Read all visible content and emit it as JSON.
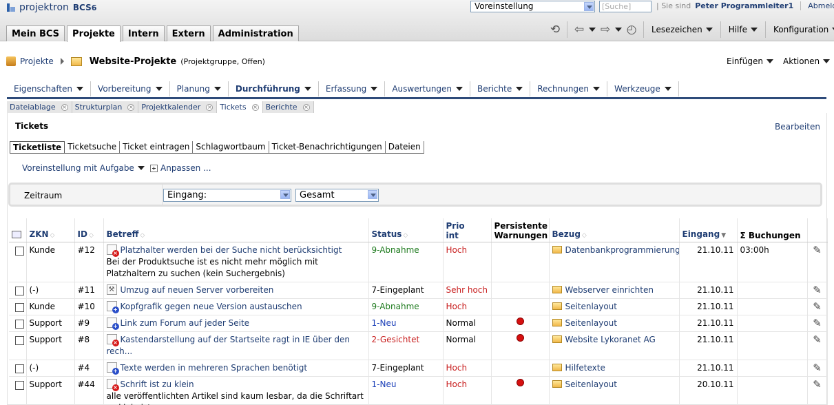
{
  "app": {
    "logo_text": "projektron",
    "logo_version": "BCS",
    "logo_num": "6"
  },
  "top": {
    "preset_value": "Voreinstellung",
    "search_placeholder": "[Suche]",
    "user_prefix": "Sie sind",
    "user_name": "Peter Programmleiter1",
    "logout": "Abmelden"
  },
  "main_tabs": [
    "Mein BCS",
    "Projekte",
    "Intern",
    "Extern",
    "Administration"
  ],
  "right_menus": {
    "bookmarks": "Lesezeichen",
    "help": "Hilfe",
    "config": "Konfiguration"
  },
  "breadcrumb": {
    "root": "Projekte",
    "current": "Website-Projekte",
    "meta": "(Projektgruppe, Offen)"
  },
  "page_menus": {
    "insert": "Einfügen",
    "actions": "Aktionen"
  },
  "section_nav": [
    "Eigenschaften",
    "Vorbereitung",
    "Planung",
    "Durchführung",
    "Erfassung",
    "Auswertungen",
    "Berichte",
    "Rechnungen",
    "Werkzeuge"
  ],
  "sub_tabs": [
    "Dateiablage",
    "Strukturplan",
    "Projektkalender",
    "Tickets",
    "Berichte"
  ],
  "panel": {
    "title": "Tickets",
    "edit": "Bearbeiten"
  },
  "ticket_tabs": [
    "Ticketliste",
    "Ticketsuche",
    "Ticket eintragen",
    "Schlagwortbaum",
    "Ticket-Benachrichtigungen",
    "Dateien"
  ],
  "view": {
    "preset": "Voreinstellung mit Aufgabe",
    "adjust": "Anpassen ..."
  },
  "filter": {
    "label": "Zeitraum",
    "field1": "Eingang:",
    "field2": "Gesamt"
  },
  "columns": {
    "zkn": "ZKN",
    "id": "ID",
    "betreff": "Betreff",
    "status": "Status",
    "prio1": "Prio",
    "prio2": "int",
    "warn1": "Persistente",
    "warn2": "Warnungen",
    "bezug": "Bezug",
    "eingang": "Eingang",
    "buchungen": "Σ Buchungen"
  },
  "rows": [
    {
      "zkn": "Kunde",
      "id": "#12",
      "subject": "Platzhalter werden bei der Suche nicht berücksichtigt",
      "desc": "Bei der Produktsuche ist es nicht mehr möglich mit Platzhaltern zu suchen (kein Suchergebnis)",
      "status": "9-Abnahme",
      "prio": "Hoch",
      "warn": false,
      "bezug": "Datenbankprogrammierung",
      "eingang": "21.10.11",
      "buchungen": "03:00h"
    },
    {
      "zkn": "(-)",
      "id": "#11",
      "subject": "Umzug auf neuen Server vorbereiten",
      "desc": "",
      "status": "7-Eingeplant",
      "prio": "Sehr hoch",
      "warn": false,
      "bezug": "Webserver einrichten",
      "eingang": "21.10.11",
      "buchungen": ""
    },
    {
      "zkn": "Kunde",
      "id": "#10",
      "subject": "Kopfgrafik gegen neue Version austauschen",
      "desc": "",
      "status": "9-Abnahme",
      "prio": "Hoch",
      "warn": false,
      "bezug": "Seitenlayout",
      "eingang": "21.10.11",
      "buchungen": ""
    },
    {
      "zkn": "Support",
      "id": "#9",
      "subject": "Link zum Forum auf jeder Seite",
      "desc": "",
      "status": "1-Neu",
      "prio": "Normal",
      "warn": true,
      "bezug": "Seitenlayout",
      "eingang": "21.10.11",
      "buchungen": ""
    },
    {
      "zkn": "Support",
      "id": "#8",
      "subject": "Kastendarstellung auf der Startseite ragt in IE über den rech...",
      "desc": "",
      "status": "2-Gesichtet",
      "prio": "Normal",
      "warn": true,
      "bezug": "Website Lykoranet AG",
      "eingang": "21.10.11",
      "buchungen": ""
    },
    {
      "zkn": "(-)",
      "id": "#4",
      "subject": "Texte werden in mehreren Sprachen benötigt",
      "desc": "",
      "status": "7-Eingeplant",
      "prio": "Hoch",
      "warn": false,
      "bezug": "Hilfetexte",
      "eingang": "21.10.11",
      "buchungen": ""
    },
    {
      "zkn": "Support",
      "id": "#44",
      "subject": "Schrift ist zu klein",
      "desc": "alle veröffentlichten Artikel sind kaum lesbar, da die Schriftart zu klein ist.",
      "status": "1-Neu",
      "prio": "Hoch",
      "warn": true,
      "bezug": "Seitenlayout",
      "eingang": "20.10.11",
      "buchungen": ""
    }
  ]
}
